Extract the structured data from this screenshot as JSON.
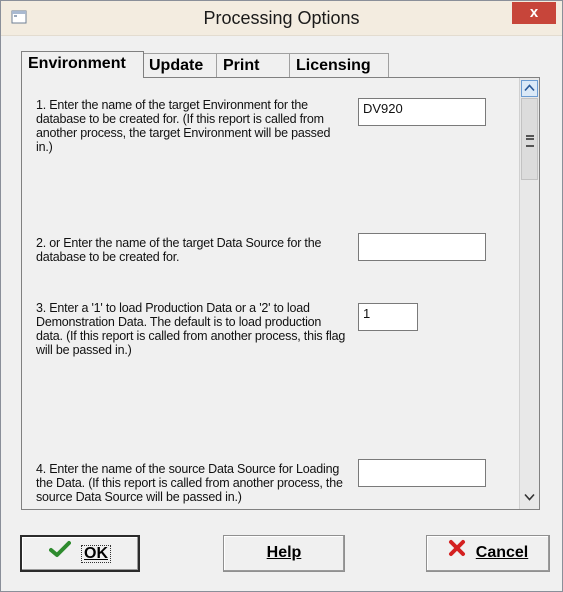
{
  "window": {
    "title": "Processing Options",
    "close_label": "x"
  },
  "tabs": [
    {
      "label": "Environment",
      "active": true
    },
    {
      "label": "Update",
      "active": false
    },
    {
      "label": "Print",
      "active": false
    },
    {
      "label": "Licensing",
      "active": false
    }
  ],
  "options": [
    {
      "text": "1.  Enter the name of the target Environment for the database to be created for.  (If this report is called from another process, the target Environment will be passed in.)",
      "value": "DV920"
    },
    {
      "text": "2.  or Enter the name of the target Data Source for the database to be created for.",
      "value": ""
    },
    {
      "text": "3.  Enter a '1' to load Production Data or a '2' to load Demonstration Data. The default is to load production data.  (If this report is called from another process, this flag will be passed in.)",
      "value": "1"
    },
    {
      "text": "4.  Enter the name of the source Data Source for Loading the Data.  (If this report is called from another process, the source Data Source will be passed in.)",
      "value": ""
    }
  ],
  "buttons": {
    "ok_label": "OK",
    "help_label": "Help",
    "cancel_label": "Cancel"
  },
  "icons": {
    "window": "window-icon",
    "ok": "checkmark-icon",
    "cancel": "red-x-icon",
    "scroll_up": "chevron-up-icon",
    "scroll_down": "chevron-down-icon"
  },
  "colors": {
    "close_button": "#c7453a",
    "ok_check": "#2e8b2e",
    "cancel_x": "#d42020",
    "scroll_up_accent": "#6b9bd1"
  }
}
